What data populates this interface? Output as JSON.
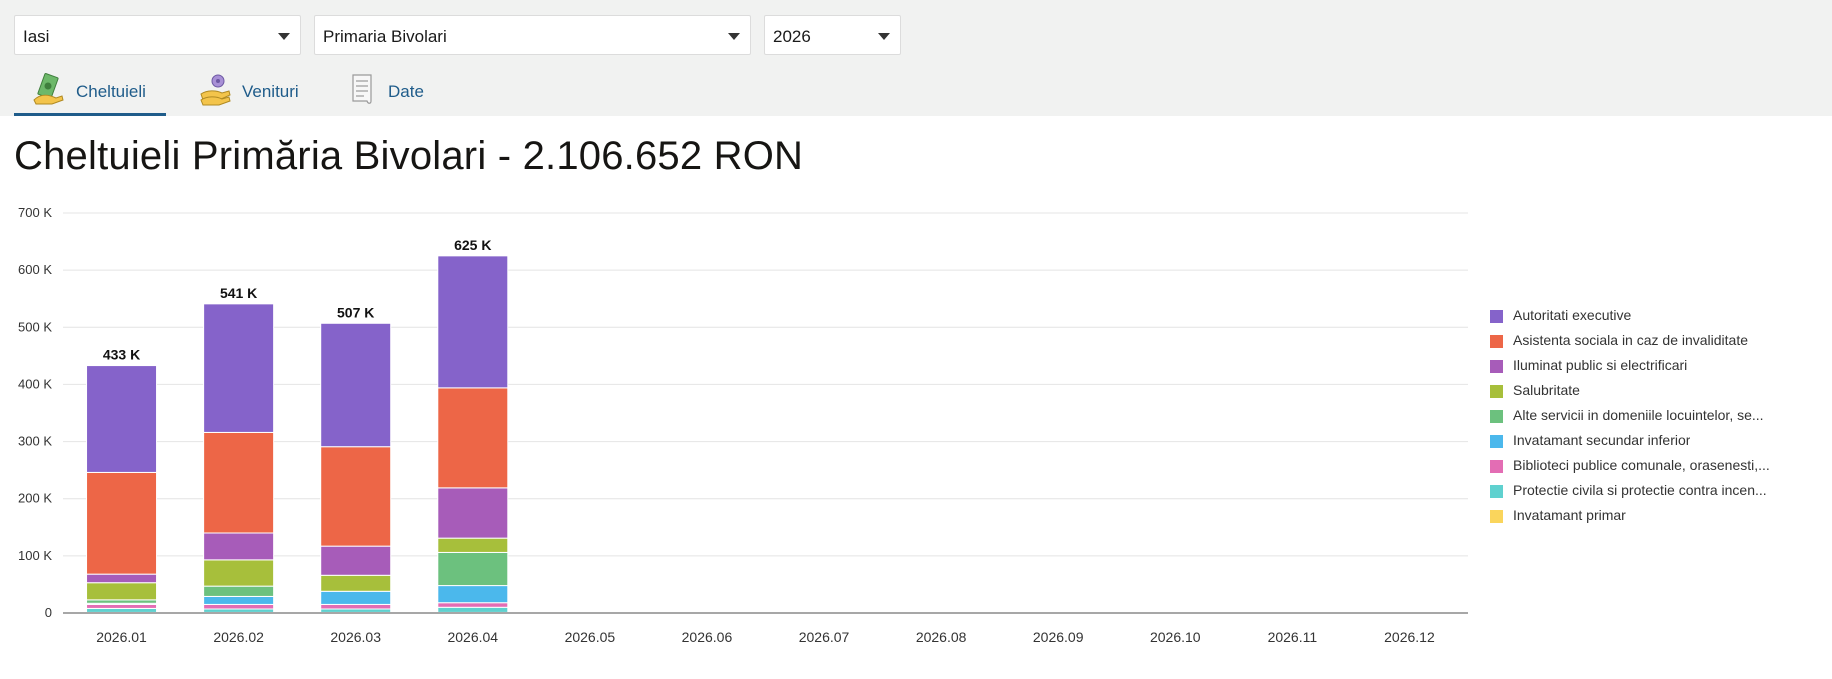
{
  "filters": {
    "county": "Iasi",
    "institution": "Primaria Bivolari",
    "year": "2026"
  },
  "tabs": [
    {
      "label": "Cheltuieli",
      "icon": "money-icon",
      "active": true
    },
    {
      "label": "Venituri",
      "icon": "coin-hand-icon",
      "active": false
    },
    {
      "label": "Date",
      "icon": "document-icon",
      "active": false
    }
  ],
  "page_title": "Cheltuieli Primăria Bivolari - 2.106.652 RON",
  "chart_data": {
    "type": "bar",
    "stacked": true,
    "categories": [
      "2026.01",
      "2026.02",
      "2026.03",
      "2026.04",
      "2026.05",
      "2026.06",
      "2026.07",
      "2026.08",
      "2026.09",
      "2026.10",
      "2026.11",
      "2026.12"
    ],
    "ylim": [
      0,
      700000
    ],
    "yticks": [
      0,
      100000,
      200000,
      300000,
      400000,
      500000,
      600000,
      700000
    ],
    "ytick_labels": [
      "0",
      "100 K",
      "200 K",
      "300 K",
      "400 K",
      "500 K",
      "600 K",
      "700 K"
    ],
    "total_labels": [
      "433 K",
      "541 K",
      "507 K",
      "625 K"
    ],
    "legend_position": "right",
    "grid": true,
    "series": [
      {
        "name": "Invatamant primar",
        "color": "#fad55c",
        "values": [
          1000,
          1000,
          1000,
          1000,
          0,
          0,
          0,
          0,
          0,
          0,
          0,
          0
        ]
      },
      {
        "name": "Protectie civila si protectie contra incen...",
        "color": "#5fd1cf",
        "values": [
          7000,
          6000,
          6000,
          9000,
          0,
          0,
          0,
          0,
          0,
          0,
          0,
          0
        ]
      },
      {
        "name": "Biblioteci publice comunale, orasenesti,...",
        "color": "#e36db4",
        "values": [
          7000,
          8000,
          8000,
          8000,
          0,
          0,
          0,
          0,
          0,
          0,
          0,
          0
        ]
      },
      {
        "name": "Invatamant secundar inferior",
        "color": "#4bb8ec",
        "values": [
          2000,
          14000,
          23000,
          30000,
          0,
          0,
          0,
          0,
          0,
          0,
          0,
          0
        ]
      },
      {
        "name": "Alte servicii in domeniile locuintelor, se...",
        "color": "#6cc17e",
        "values": [
          6000,
          18000,
          0,
          58000,
          0,
          0,
          0,
          0,
          0,
          0,
          0,
          0
        ]
      },
      {
        "name": "Salubritate",
        "color": "#a7bf3b",
        "values": [
          30000,
          46000,
          28000,
          25000,
          0,
          0,
          0,
          0,
          0,
          0,
          0,
          0
        ]
      },
      {
        "name": "Iluminat public si electrificari",
        "color": "#a75cb9",
        "values": [
          15000,
          47000,
          51000,
          88000,
          0,
          0,
          0,
          0,
          0,
          0,
          0,
          0
        ]
      },
      {
        "name": "Asistenta sociala in caz de invaliditate",
        "color": "#ed6647",
        "values": [
          178000,
          176000,
          174000,
          175000,
          0,
          0,
          0,
          0,
          0,
          0,
          0,
          0
        ]
      },
      {
        "name": "Autoritati executive",
        "color": "#8563ca",
        "values": [
          187000,
          225000,
          216000,
          231000,
          0,
          0,
          0,
          0,
          0,
          0,
          0,
          0
        ]
      }
    ]
  }
}
